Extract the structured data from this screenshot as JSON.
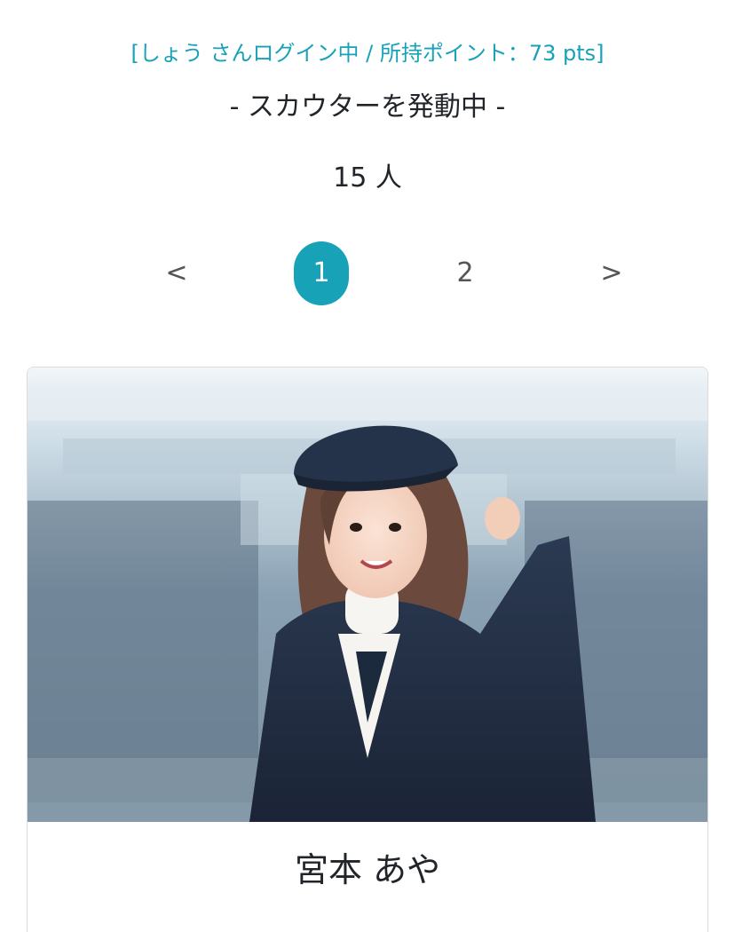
{
  "header": {
    "login_status": "[しょう さんログイン中 / 所持ポイント：73 pts]",
    "scouter_title": "- スカウターを発動中 -",
    "count": "15 人"
  },
  "pagination": {
    "prev": "<",
    "pages": [
      "1",
      "2"
    ],
    "current": "1",
    "next": ">"
  },
  "profile_card": {
    "name": "宮本 あや"
  },
  "colors": {
    "accent": "#17a2b8",
    "text": "#212529"
  }
}
